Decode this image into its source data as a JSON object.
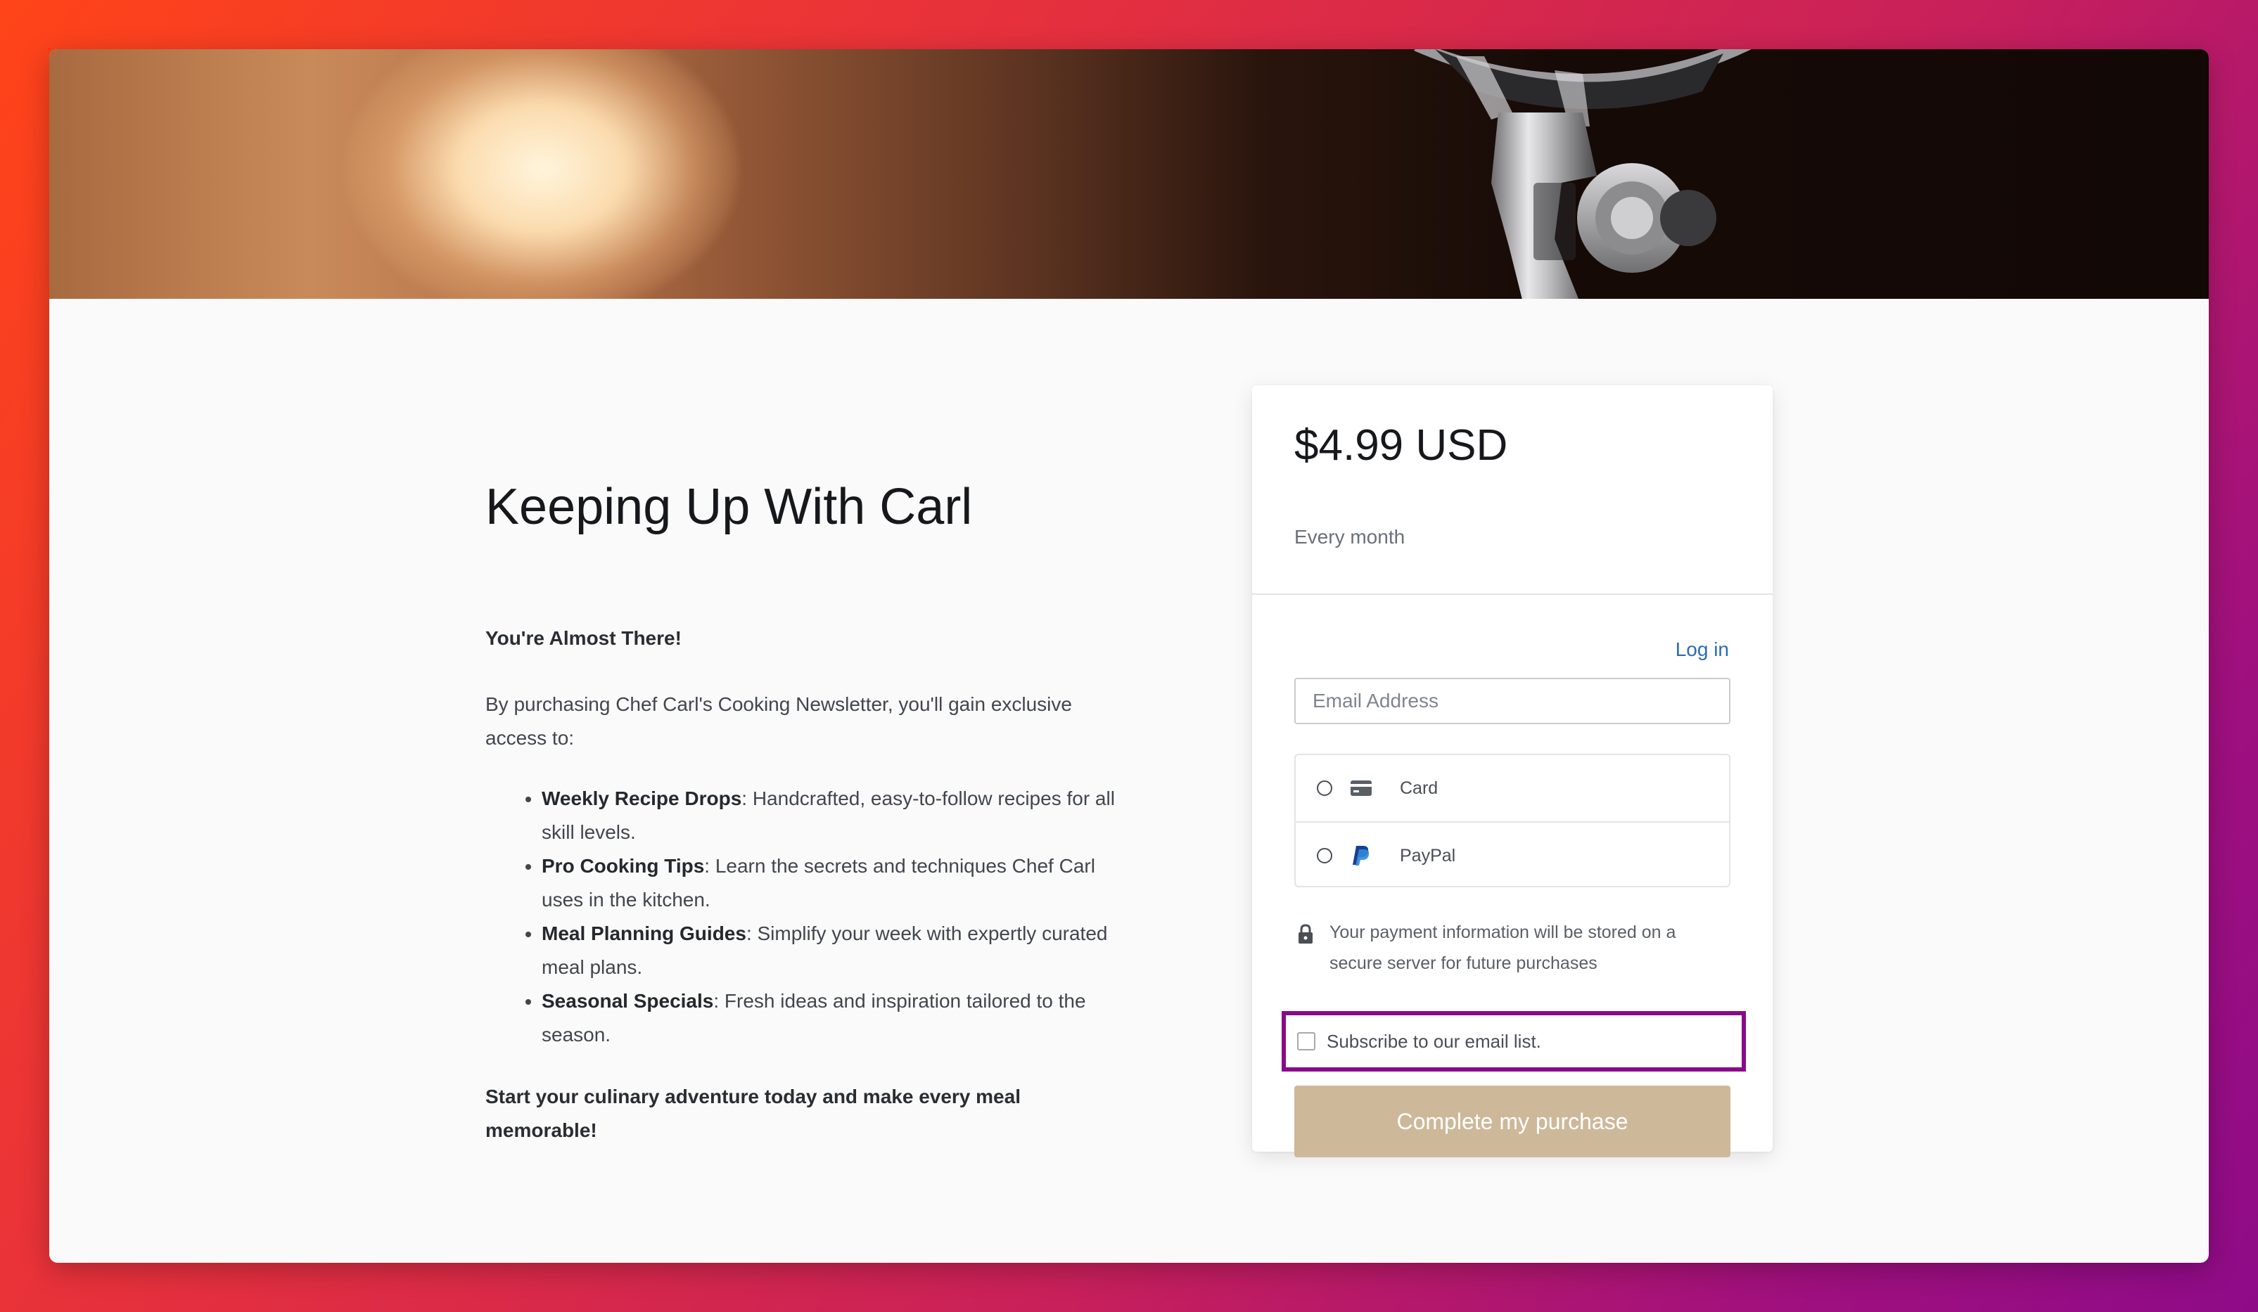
{
  "product": {
    "title": "Keeping Up With Carl",
    "lead": "You're Almost There!",
    "intro": "By purchasing Chef Carl's Cooking Newsletter, you'll gain exclusive access to:",
    "benefits": [
      {
        "name": "Weekly Recipe Drops",
        "text": ": Handcrafted, easy-to-follow recipes for all skill levels."
      },
      {
        "name": "Pro Cooking Tips",
        "text": ": Learn the secrets and techniques Chef Carl uses in the kitchen."
      },
      {
        "name": "Meal Planning Guides",
        "text": ": Simplify your week with expertly curated meal plans."
      },
      {
        "name": "Seasonal Specials",
        "text": ": Fresh ideas and inspiration tailored to the season."
      }
    ],
    "closing": "Start your culinary adventure today and make every meal memorable!"
  },
  "checkout": {
    "price": "$4.99 USD",
    "period": "Every month",
    "login_label": "Log in",
    "email_placeholder": "Email Address",
    "email_value": "",
    "payment_methods": [
      {
        "label": "Card",
        "icon": "credit-card-icon",
        "selected": false
      },
      {
        "label": "PayPal",
        "icon": "paypal-icon",
        "selected": false
      }
    ],
    "secure_note": "Your payment information will be stored on a secure server for future purchases",
    "secure_icon": "lock-icon",
    "subscribe_label": "Subscribe to our email list.",
    "subscribe_checked": false,
    "submit_label": "Complete my purchase"
  },
  "colors": {
    "accent_button": "#cdb899",
    "link": "#2b6cb0",
    "highlight_border": "#8a0a8a"
  }
}
